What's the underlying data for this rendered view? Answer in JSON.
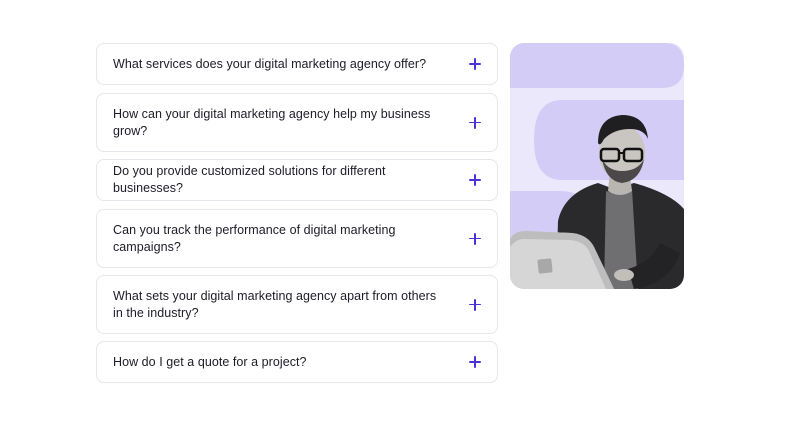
{
  "faq": {
    "items": [
      {
        "question": "What services does your digital marketing agency offer?"
      },
      {
        "question": "How can your digital marketing agency help my business grow?"
      },
      {
        "question": "Do you provide customized solutions for different businesses?"
      },
      {
        "question": "Can you track the performance of digital marketing campaigns?"
      },
      {
        "question": "What sets your digital marketing agency apart from others in the industry?"
      },
      {
        "question": "How do I get a quote for a project?"
      }
    ],
    "expand_icon": "plus-icon"
  },
  "colors": {
    "accent": "#4b32d6",
    "card_background": "#ebe8fb",
    "card_shape": "#d3ccf7",
    "border": "#e6e6ec",
    "text": "#1c1c28"
  }
}
